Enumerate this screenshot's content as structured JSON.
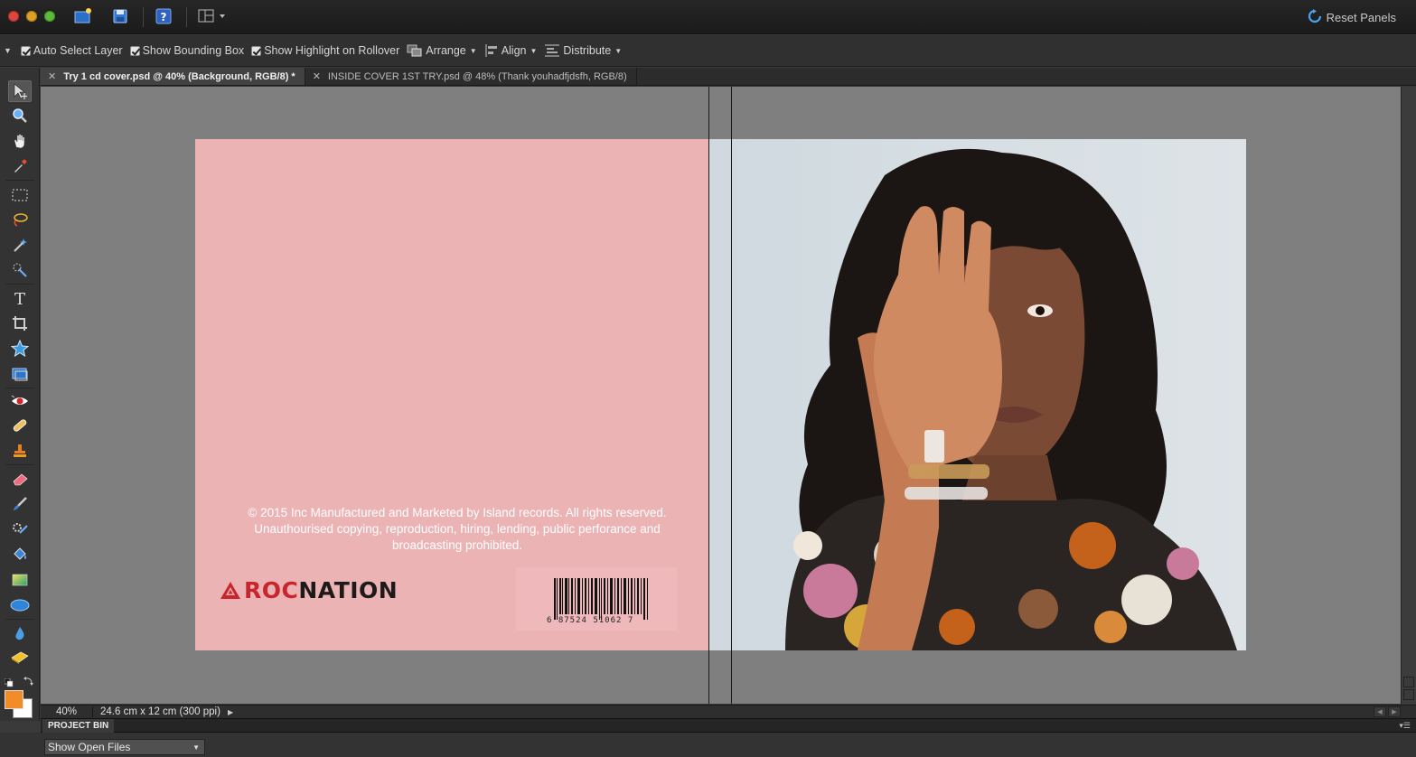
{
  "toolbar": {
    "reset_panels_label": "Reset Panels"
  },
  "options": {
    "auto_select_layer": "Auto Select Layer",
    "show_bounding_box": "Show Bounding Box",
    "show_highlight_on_rollover": "Show Highlight on Rollover",
    "arrange": "Arrange",
    "align": "Align",
    "distribute": "Distribute"
  },
  "tabs": [
    {
      "label": "Try 1 cd cover.psd @ 40% (Background, RGB/8) *",
      "active": true
    },
    {
      "label": "INSIDE COVER 1ST TRY.psd @ 48% (Thank youhadfjdsfh, RGB/8)",
      "active": false
    }
  ],
  "document": {
    "legal_line1": "© 2015 Inc Manufactured and Marketed by Island records. All rights reserved.",
    "legal_line2": "Unauthourised copying, reproduction, hiring, lending, public perforance and",
    "legal_line3": "broadcasting prohibited.",
    "logo_part1": "ROC",
    "logo_part2": "NATION",
    "barcode_digits": "6  87524  51062  7"
  },
  "status": {
    "zoom": "40%",
    "dimensions": "24.6 cm x 12 cm (300 ppi)"
  },
  "bin": {
    "label": "PROJECT BIN",
    "select_value": "Show Open Files"
  },
  "colors": {
    "foreground": "#f28c28",
    "background": "#ffffff",
    "cover_pink": "#ecb3b5"
  }
}
